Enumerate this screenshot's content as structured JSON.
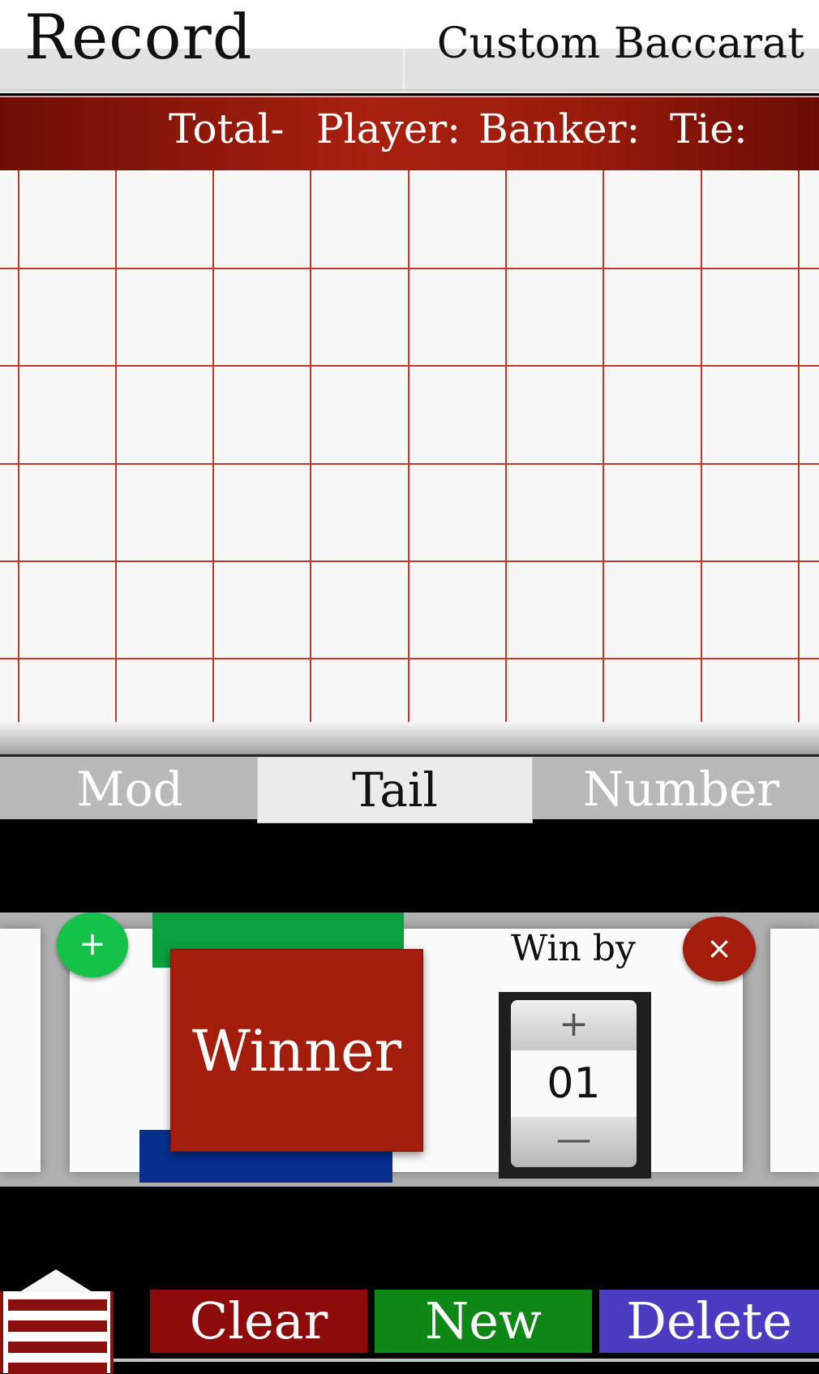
{
  "header": {
    "title": "Record",
    "subtitle": "Custom Baccarat"
  },
  "totals": {
    "total": "Total-",
    "player": "Player:",
    "banker": "Banker:",
    "tie": "Tie:"
  },
  "tabs": [
    {
      "label": "Mod",
      "selected": false
    },
    {
      "label": "Tail",
      "selected": true
    },
    {
      "label": "Number",
      "selected": false
    }
  ],
  "editor": {
    "add_icon": "plus-icon",
    "add_symbol": "+",
    "close_icon": "close-icon",
    "close_symbol": "×",
    "winner_label": "Winner",
    "win_by_label": "Win by",
    "stepper": {
      "plus_symbol": "+",
      "value": "01",
      "minus_symbol": "—"
    },
    "colors": {
      "player": "#0c9f3e",
      "banker": "#a21d0b",
      "tie_or_blue": "#062f8f"
    }
  },
  "actions": {
    "menu_icon": "menu-icon",
    "clear": "Clear",
    "new": "New",
    "delete": "Delete",
    "colors": {
      "clear": "#8e0b0b",
      "new": "#0e8717",
      "delete": "#4a3bc1"
    }
  }
}
